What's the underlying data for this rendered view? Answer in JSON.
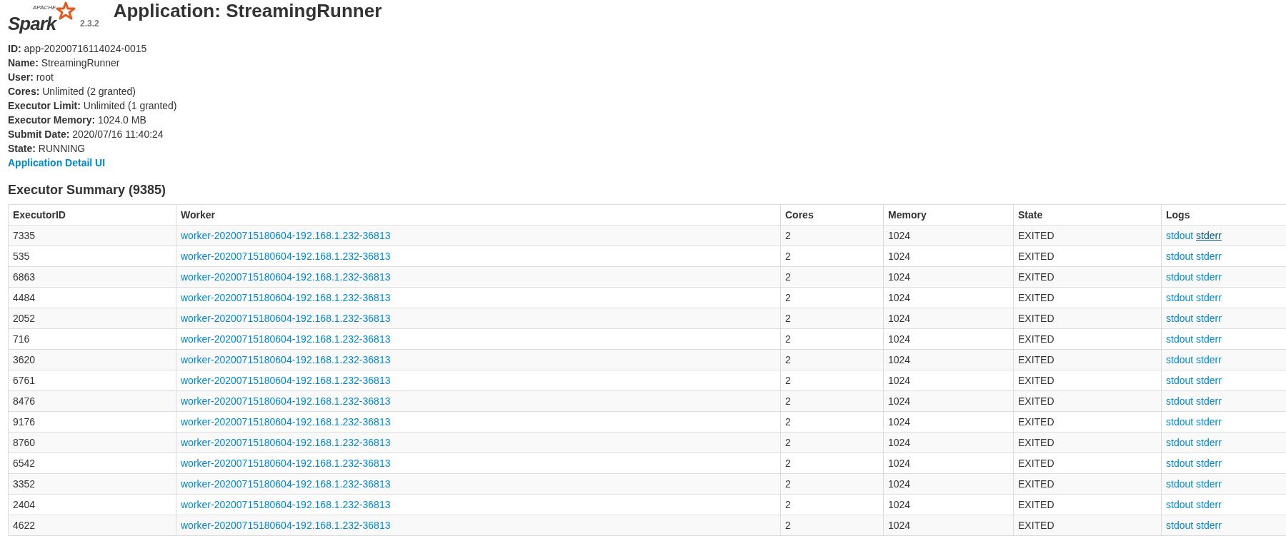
{
  "header": {
    "logo_word": "Spark",
    "logo_badge": "APACHE",
    "version": "2.3.2",
    "title": "Application: StreamingRunner"
  },
  "info": [
    {
      "label": "ID:",
      "value": "app-20200716114024-0015"
    },
    {
      "label": "Name:",
      "value": "StreamingRunner"
    },
    {
      "label": "User:",
      "value": "root"
    },
    {
      "label": "Cores:",
      "value": "Unlimited (2 granted)"
    },
    {
      "label": "Executor Limit:",
      "value": "Unlimited (1 granted)"
    },
    {
      "label": "Executor Memory:",
      "value": "1024.0 MB"
    },
    {
      "label": "Submit Date:",
      "value": "2020/07/16 11:40:24"
    },
    {
      "label": "State:",
      "value": "RUNNING"
    }
  ],
  "detail_link": "Application Detail UI",
  "section_title": "Executor Summary (9385)",
  "table": {
    "columns": [
      "ExecutorID",
      "Worker",
      "Cores",
      "Memory",
      "State",
      "Logs"
    ],
    "rows": [
      {
        "id": "7335",
        "worker": "worker-20200715180604-192.168.1.232-36813",
        "cores": "2",
        "memory": "1024",
        "state": "EXITED",
        "logs": [
          {
            "label": "stdout",
            "underlined": false
          },
          {
            "label": "stderr",
            "underlined": true
          }
        ]
      },
      {
        "id": "535",
        "worker": "worker-20200715180604-192.168.1.232-36813",
        "cores": "2",
        "memory": "1024",
        "state": "EXITED",
        "logs": [
          {
            "label": "stdout",
            "underlined": false
          },
          {
            "label": "stderr",
            "underlined": false
          }
        ]
      },
      {
        "id": "6863",
        "worker": "worker-20200715180604-192.168.1.232-36813",
        "cores": "2",
        "memory": "1024",
        "state": "EXITED",
        "logs": [
          {
            "label": "stdout",
            "underlined": false
          },
          {
            "label": "stderr",
            "underlined": false
          }
        ]
      },
      {
        "id": "4484",
        "worker": "worker-20200715180604-192.168.1.232-36813",
        "cores": "2",
        "memory": "1024",
        "state": "EXITED",
        "logs": [
          {
            "label": "stdout",
            "underlined": false
          },
          {
            "label": "stderr",
            "underlined": false
          }
        ]
      },
      {
        "id": "2052",
        "worker": "worker-20200715180604-192.168.1.232-36813",
        "cores": "2",
        "memory": "1024",
        "state": "EXITED",
        "logs": [
          {
            "label": "stdout",
            "underlined": false
          },
          {
            "label": "stderr",
            "underlined": false
          }
        ]
      },
      {
        "id": "716",
        "worker": "worker-20200715180604-192.168.1.232-36813",
        "cores": "2",
        "memory": "1024",
        "state": "EXITED",
        "logs": [
          {
            "label": "stdout",
            "underlined": false
          },
          {
            "label": "stderr",
            "underlined": false
          }
        ]
      },
      {
        "id": "3620",
        "worker": "worker-20200715180604-192.168.1.232-36813",
        "cores": "2",
        "memory": "1024",
        "state": "EXITED",
        "logs": [
          {
            "label": "stdout",
            "underlined": false
          },
          {
            "label": "stderr",
            "underlined": false
          }
        ]
      },
      {
        "id": "6761",
        "worker": "worker-20200715180604-192.168.1.232-36813",
        "cores": "2",
        "memory": "1024",
        "state": "EXITED",
        "logs": [
          {
            "label": "stdout",
            "underlined": false
          },
          {
            "label": "stderr",
            "underlined": false
          }
        ]
      },
      {
        "id": "8476",
        "worker": "worker-20200715180604-192.168.1.232-36813",
        "cores": "2",
        "memory": "1024",
        "state": "EXITED",
        "logs": [
          {
            "label": "stdout",
            "underlined": false
          },
          {
            "label": "stderr",
            "underlined": false
          }
        ]
      },
      {
        "id": "9176",
        "worker": "worker-20200715180604-192.168.1.232-36813",
        "cores": "2",
        "memory": "1024",
        "state": "EXITED",
        "logs": [
          {
            "label": "stdout",
            "underlined": false
          },
          {
            "label": "stderr",
            "underlined": false
          }
        ]
      },
      {
        "id": "8760",
        "worker": "worker-20200715180604-192.168.1.232-36813",
        "cores": "2",
        "memory": "1024",
        "state": "EXITED",
        "logs": [
          {
            "label": "stdout",
            "underlined": false
          },
          {
            "label": "stderr",
            "underlined": false
          }
        ]
      },
      {
        "id": "6542",
        "worker": "worker-20200715180604-192.168.1.232-36813",
        "cores": "2",
        "memory": "1024",
        "state": "EXITED",
        "logs": [
          {
            "label": "stdout",
            "underlined": false
          },
          {
            "label": "stderr",
            "underlined": false
          }
        ]
      },
      {
        "id": "3352",
        "worker": "worker-20200715180604-192.168.1.232-36813",
        "cores": "2",
        "memory": "1024",
        "state": "EXITED",
        "logs": [
          {
            "label": "stdout",
            "underlined": false
          },
          {
            "label": "stderr",
            "underlined": false
          }
        ]
      },
      {
        "id": "2404",
        "worker": "worker-20200715180604-192.168.1.232-36813",
        "cores": "2",
        "memory": "1024",
        "state": "EXITED",
        "logs": [
          {
            "label": "stdout",
            "underlined": false
          },
          {
            "label": "stderr",
            "underlined": false
          }
        ]
      },
      {
        "id": "4622",
        "worker": "worker-20200715180604-192.168.1.232-36813",
        "cores": "2",
        "memory": "1024",
        "state": "EXITED",
        "logs": [
          {
            "label": "stdout",
            "underlined": false
          },
          {
            "label": "stderr",
            "underlined": false
          }
        ]
      }
    ]
  }
}
